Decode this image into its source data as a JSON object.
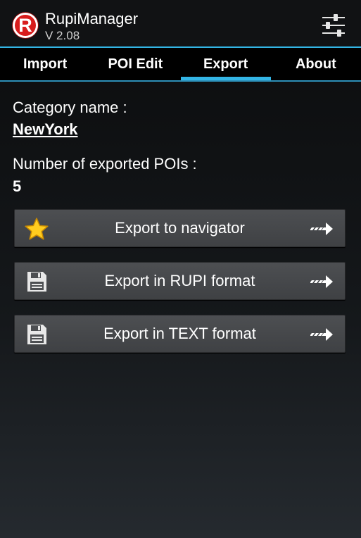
{
  "app": {
    "title": "RupiManager",
    "version": "V 2.08",
    "logo_letter": "R",
    "logo_color": "#d81c1c",
    "accent_color": "#33b5e5",
    "settings_icon": "sliders-icon"
  },
  "tabs": [
    {
      "label": "Import",
      "active": false
    },
    {
      "label": "POI Edit",
      "active": false
    },
    {
      "label": "Export",
      "active": true
    },
    {
      "label": "About",
      "active": false
    }
  ],
  "export": {
    "category_label": "Category name :",
    "category_value": "NewYork",
    "count_label": "Number of exported POIs :",
    "count_value": "5"
  },
  "buttons": [
    {
      "label": "Export to navigator",
      "icon": "star-icon",
      "trailing_icon": "arrow-right-icon"
    },
    {
      "label": "Export in RUPI format",
      "icon": "floppy-disk-icon",
      "trailing_icon": "arrow-right-icon"
    },
    {
      "label": "Export in TEXT format",
      "icon": "floppy-disk-icon",
      "trailing_icon": "arrow-right-icon"
    }
  ]
}
